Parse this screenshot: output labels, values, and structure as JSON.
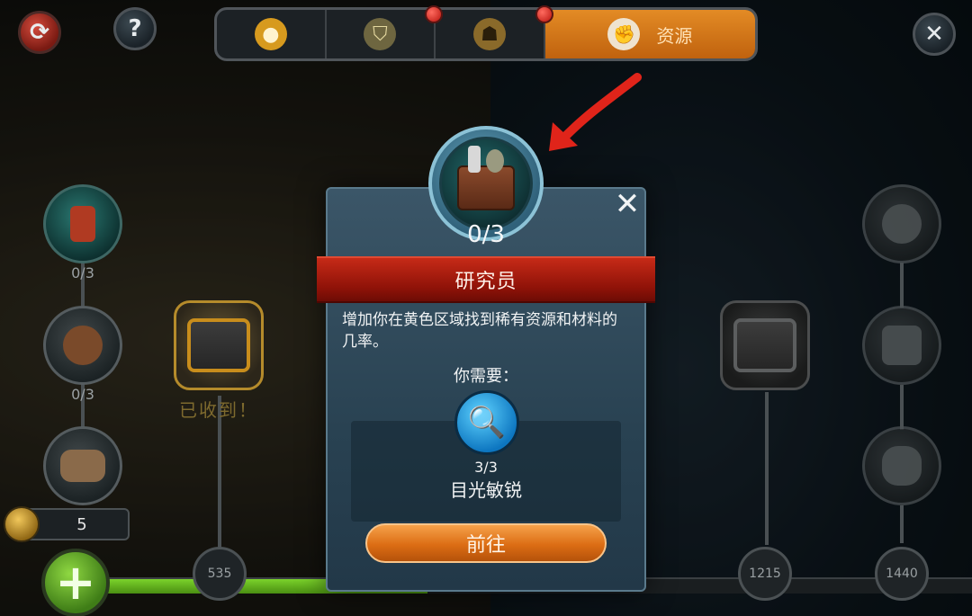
{
  "top_bar": {
    "tabs": [
      {
        "icon": "lightbulb-icon",
        "label": ""
      },
      {
        "icon": "shield-crossed-icon",
        "label": ""
      },
      {
        "icon": "gasmask-icon",
        "label": ""
      },
      {
        "icon": "fist-icon",
        "label": "资源",
        "active": true
      }
    ],
    "left_buttons": [
      {
        "icon": "refresh-icon"
      },
      {
        "icon": "help-icon",
        "glyph": "?"
      }
    ],
    "close_glyph": "✕"
  },
  "tree": {
    "left_counts": [
      "0/3",
      "0/3"
    ],
    "received_label": "已收到！",
    "milestones": [
      "535",
      "1215",
      "1440"
    ],
    "resource_count": "5",
    "progress_fraction": 0.37
  },
  "popup": {
    "progress": "0/3",
    "title": "研究员",
    "description": "增加你在黄色区域找到稀有资源和材料的几率。",
    "need_label": "你需要：",
    "requirement": {
      "icon": "magnifier-lightning-icon",
      "count": "3/3",
      "name": "目光敏锐"
    },
    "go_label": "前往",
    "close_glyph": "✕"
  },
  "colors": {
    "accent_orange": "#dc6d14",
    "banner_red": "#8e1208",
    "panel_blue": "#2c4758",
    "arrow_red": "#e0241a"
  }
}
